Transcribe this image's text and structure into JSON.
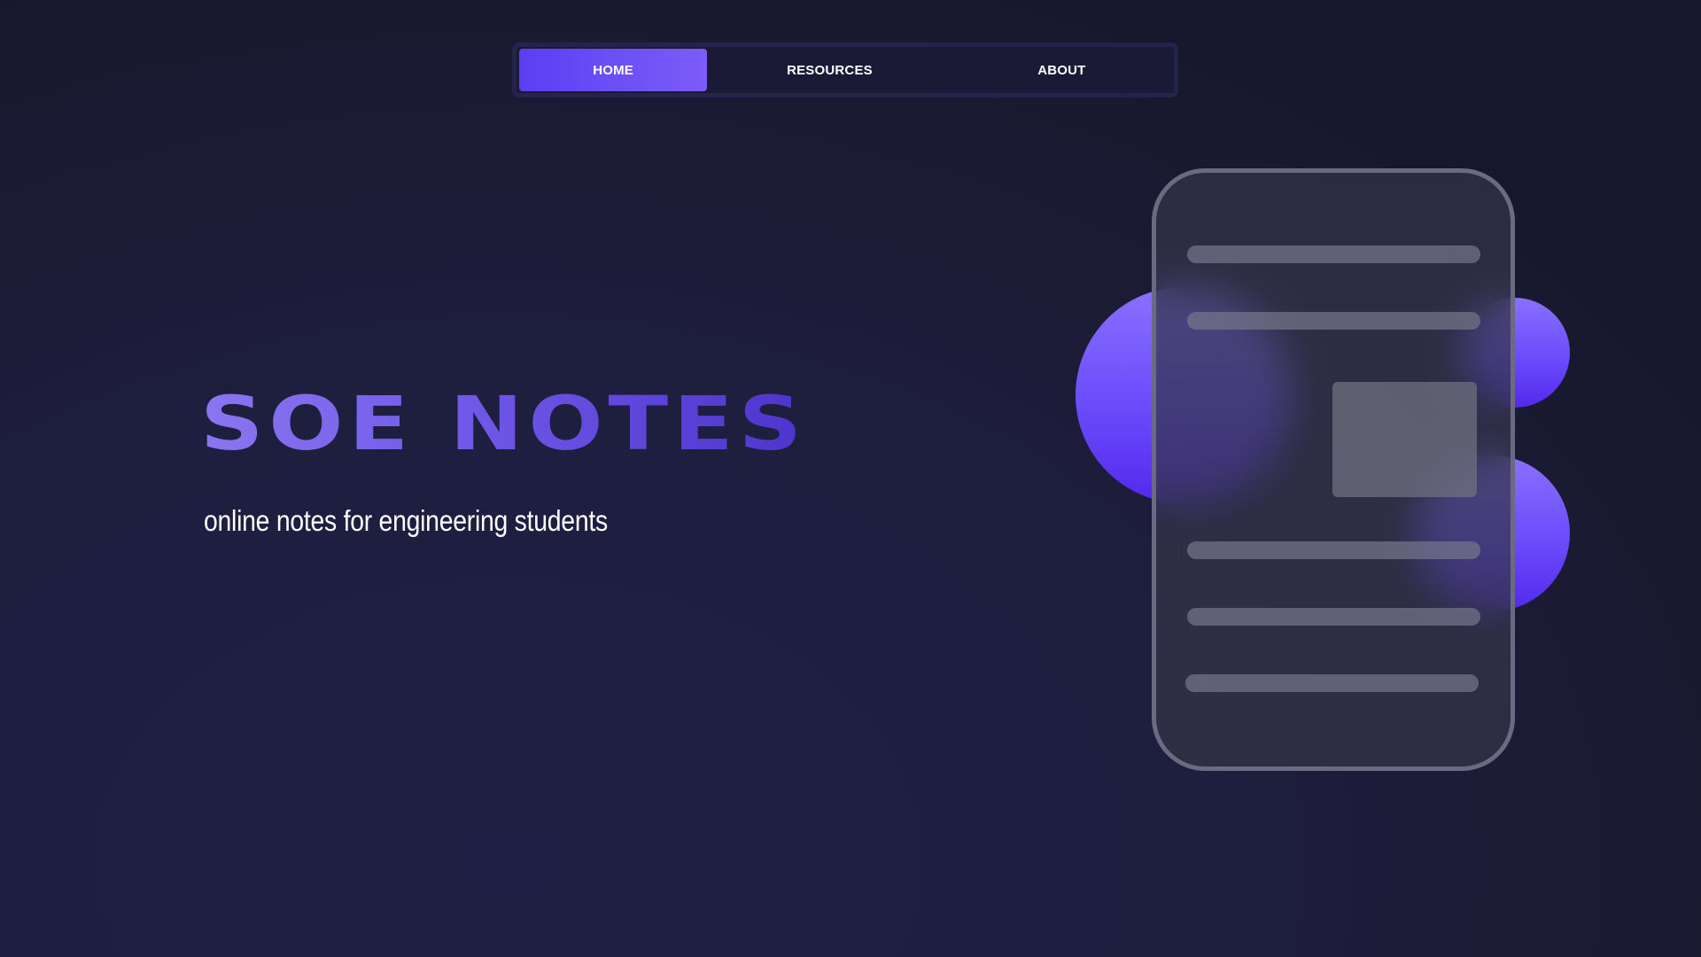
{
  "nav": {
    "items": [
      {
        "label": "HOME",
        "active": true
      },
      {
        "label": "RESOURCES",
        "active": false
      },
      {
        "label": "ABOUT",
        "active": false
      }
    ]
  },
  "hero": {
    "title": "SOE NOTES",
    "subtitle": "online notes for engineering students"
  },
  "colors": {
    "background": "#1e1e3f",
    "accent": "#6a4cfb",
    "title_gradient_start": "#8b76f0",
    "title_gradient_end": "#4d34cc",
    "nav_background": "#1a1a36"
  }
}
